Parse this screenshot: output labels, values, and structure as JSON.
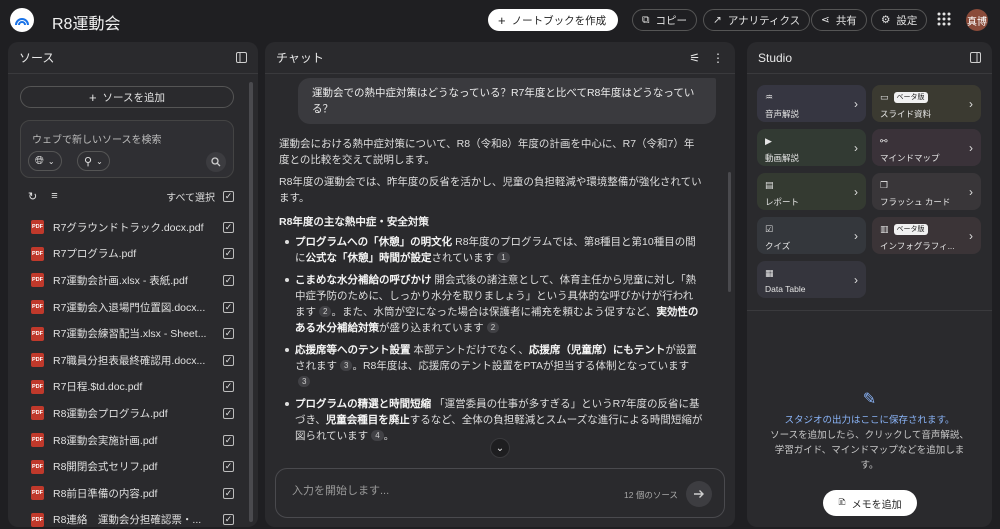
{
  "header": {
    "title": "R8運動会",
    "create_notebook": "ノートブックを作成",
    "copy": "コピー",
    "analytics": "アナリティクス",
    "share": "共有",
    "settings": "設定",
    "avatar": "真博"
  },
  "sources": {
    "title": "ソース",
    "add_source": "ソースを追加",
    "search_placeholder": "ウェブで新しいソースを検索",
    "select_all": "すべて選択",
    "items": [
      {
        "name": "R7グラウンドトラック.docx.pdf"
      },
      {
        "name": "R7プログラム.pdf"
      },
      {
        "name": "R7運動会計画.xlsx - 表紙.pdf"
      },
      {
        "name": "R7運動会入退場門位置図.docx..."
      },
      {
        "name": "R7運動会練習配当.xlsx - Sheet..."
      },
      {
        "name": "R7職員分担表最終確認用.docx..."
      },
      {
        "name": "R7日程.$td.doc.pdf"
      },
      {
        "name": "R8運動会プログラム.pdf"
      },
      {
        "name": "R8運動会実施計画.pdf"
      },
      {
        "name": "R8開閉会式セリフ.pdf"
      },
      {
        "name": "R8前日準備の内容.pdf"
      },
      {
        "name": "R8連絡　運動会分担確認票・..."
      }
    ],
    "pdf_label": "PDF"
  },
  "chat": {
    "title": "チャット",
    "user_message": "運動会での熱中症対策はどうなっている？R7年度と比べてR8年度はどうなっている？",
    "intro1": "運動会における熱中症対策について、R8（令和8）年度の計画を中心に、R7（令和7）年度との比較を交えて説明します。",
    "intro2": "R8年度の運動会では、昨年度の反省を活かし、児童の負担軽減や環境整備が強化されています。",
    "heading": "R8年度の主な熱中症・安全対策",
    "bullets": [
      {
        "b1": "プログラムへの「休憩」の明文化",
        "t1": " R8年度のプログラムでは、第8種目と第10種目の間に",
        "b2": "公式な「休憩」時間が設定",
        "t2": "されています",
        "cite": "1",
        "t3": "",
        "b3": "",
        "t4": "",
        "cite2": ""
      },
      {
        "b1": "こまめな水分補給の呼びかけ",
        "t1": " 開会式後の諸注意として、体育主任から児童に対し「熱中症予防のために、しっかり水分を取りましょう」という具体的な呼びかけが行われます",
        "b2": "",
        "t2": "",
        "cite": "2",
        "t3": "。また、水筒が空になった場合は保護者に補充を頼むよう促すなど、",
        "b3": "実効性のある水分補給対策",
        "t4": "が盛り込まれています",
        "cite2": "2"
      },
      {
        "b1": "応援席等へのテント設置",
        "t1": " 本部テントだけでなく、",
        "b2": "応援席（児童席）にもテント",
        "t2": "が設置されます",
        "cite": "3",
        "t3": "。R8年度は、応援席のテント設置をPTAが担当する体制となっています",
        "b3": "",
        "t4": "",
        "cite2": "3"
      },
      {
        "b1": "プログラムの精選と時間短縮",
        "t1": " 「運営委員の仕事が多すぎる」というR7年度の反省に基づき、",
        "b2": "児童会種目を廃止",
        "t2": "するなど、全体の負担軽減とスムーズな進行による時間短縮が図られています",
        "cite": "4",
        "t3": "。",
        "b3": "",
        "t4": "",
        "cite2": ""
      }
    ],
    "input_placeholder": "入力を開始します...",
    "source_count": "12 個のソース"
  },
  "studio": {
    "title": "Studio",
    "tiles": [
      {
        "label": "音声解説",
        "icon": "waveform-icon",
        "beta": ""
      },
      {
        "label": "スライド資料",
        "icon": "slides-icon",
        "beta": "ベータ版"
      },
      {
        "label": "動画解説",
        "icon": "video-icon",
        "beta": ""
      },
      {
        "label": "マインドマップ",
        "icon": "mindmap-icon",
        "beta": ""
      },
      {
        "label": "レポート",
        "icon": "report-icon",
        "beta": ""
      },
      {
        "label": "フラッシュ カード",
        "icon": "flashcard-icon",
        "beta": ""
      },
      {
        "label": "クイズ",
        "icon": "quiz-icon",
        "beta": ""
      },
      {
        "label": "インフォグラフィ...",
        "icon": "infographic-icon",
        "beta": "ベータ版"
      },
      {
        "label": "Data Table",
        "icon": "table-icon",
        "beta": ""
      }
    ],
    "tile_colors": [
      "#363641",
      "#3b3a31",
      "#323a33",
      "#3a3239",
      "#343a31",
      "#393639",
      "#34373c",
      "#3b3437",
      "#35353d"
    ],
    "empty_title": "スタジオの出力はここに保存されます。",
    "empty_desc": "ソースを追加したら、クリックして音声解説、学習ガイド、マインドマップなどを追加します。",
    "add_memo": "メモを追加"
  }
}
